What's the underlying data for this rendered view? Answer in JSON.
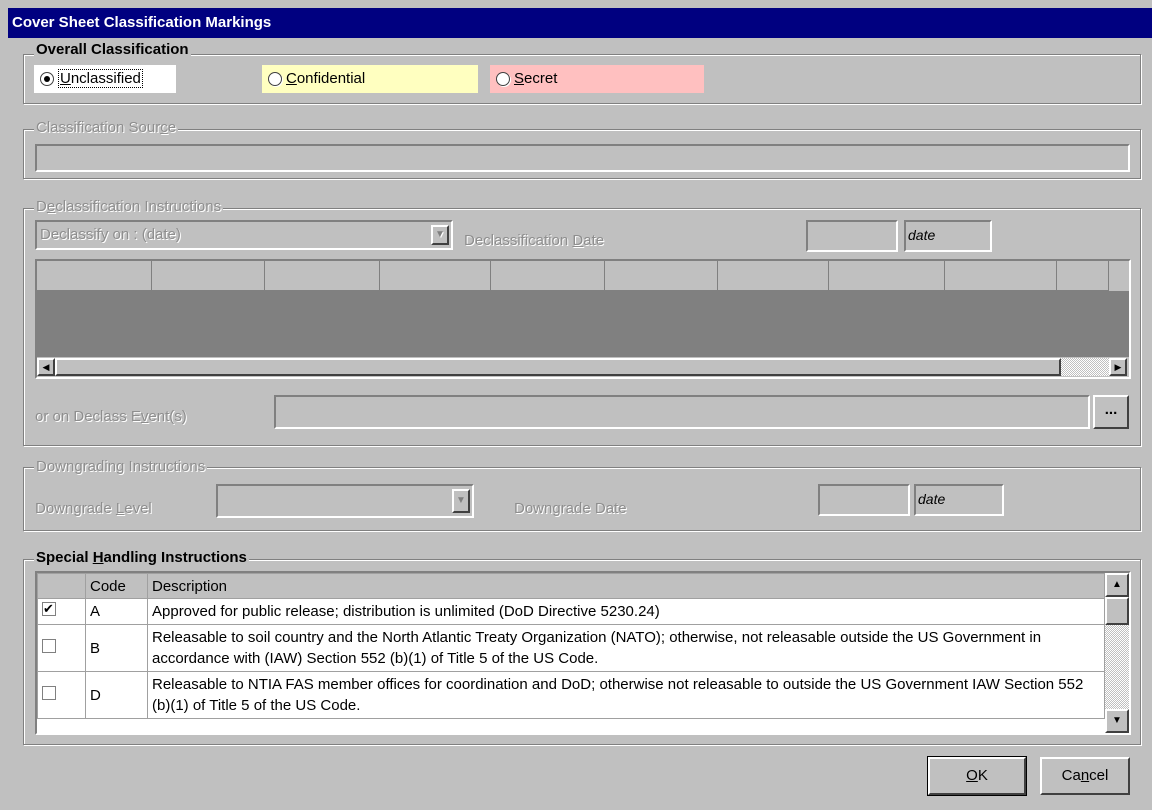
{
  "window": {
    "title": "Cover Sheet Classification Markings"
  },
  "overall": {
    "label": "Overall Classification",
    "options": [
      {
        "pre": "",
        "key": "U",
        "rest": "nclassified",
        "selected": true,
        "bg": "#ffffff"
      },
      {
        "pre": "",
        "key": "C",
        "rest": "onfidential",
        "selected": false,
        "bg": "#ffffc0"
      },
      {
        "pre": "",
        "key": "S",
        "rest": "ecret",
        "selected": false,
        "bg": "#ffc0c0"
      }
    ]
  },
  "source": {
    "label_pre": "Classification Sour",
    "label_key": "c",
    "label_post": "e",
    "value": ""
  },
  "declass": {
    "label_pre": "D",
    "label_key": "e",
    "label_post": "classification Instructions",
    "dropdown_value": "Declassify on : (date)",
    "date_label_pre": "Declassification ",
    "date_label_key": "D",
    "date_label_post": "ate",
    "date_value": "",
    "date_placeholder": "date",
    "event_label_pre": "or on Declass E",
    "event_label_key": "v",
    "event_label_post": "ent(s)",
    "event_value": "",
    "browse_label": "..."
  },
  "downgrade": {
    "label": "Downgrading Instructions",
    "level_label_pre": "Downgrade ",
    "level_label_key": "L",
    "level_label_post": "evel",
    "level_value": "",
    "date_label": "Downgrade Date",
    "date_value": "",
    "date_placeholder": "date"
  },
  "special": {
    "label_pre": "Special ",
    "label_key": "H",
    "label_post": "andling Instructions",
    "columns": [
      "",
      "Code",
      "Description"
    ],
    "rows": [
      {
        "checked": true,
        "code": "A",
        "description": "Approved for public release; distribution is unlimited (DoD Directive 5230.24)"
      },
      {
        "checked": false,
        "code": "B",
        "description": "Releasable to soil country and the North Atlantic Treaty Organization (NATO); otherwise, not releasable outside the US Government in accordance with (IAW) Section 552 (b)(1) of Title 5 of the US Code."
      },
      {
        "checked": false,
        "code": "D",
        "description": "Releasable to NTIA FAS member offices for coordination and DoD; otherwise not releasable to outside the US Government IAW Section 552 (b)(1) of Title 5 of the US Code."
      }
    ]
  },
  "buttons": {
    "ok_key": "O",
    "ok_rest": "K",
    "cancel_pre": "Ca",
    "cancel_key": "n",
    "cancel_post": "cel"
  },
  "icons": {
    "dropdown": "chevron-down-icon",
    "scroll_left": "arrow-left-icon",
    "scroll_right": "arrow-right-icon",
    "scroll_up": "arrow-up-icon",
    "scroll_down": "arrow-down-icon",
    "radio": "radio-icon",
    "checkbox": "checkbox-icon"
  }
}
